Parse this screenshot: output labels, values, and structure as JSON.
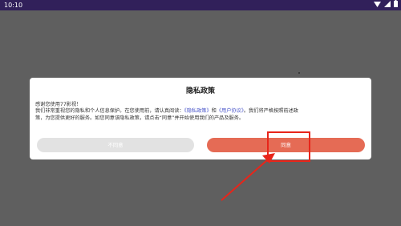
{
  "status_bar": {
    "time": "10:10"
  },
  "dialog": {
    "title": "隐私政策",
    "greeting": "感谢您使用77影视！",
    "line1_a": "我们非常重视您的隐私和个人信息保护。在您使用前，请认真阅读：",
    "privacy_link": "《隐私政策》",
    "and": "和",
    "terms_link": "《用户协议》",
    "line1_b": "。我们将严格按照前述政",
    "line2": "策，为您提供更好的服务。如您同意该隐私政策，请点击“同意”并开始使用我们的产品及服务。",
    "decline_label": "不同意",
    "agree_label": "同意"
  },
  "colors": {
    "status_bar": "#31205a",
    "overlay": "#5f5f5f",
    "agree_button": "#e56b55",
    "decline_button": "#e2e2e2",
    "link": "#4a56c9",
    "annotation": "#e8251a"
  },
  "icons": [
    "wifi-icon",
    "signal-icon",
    "battery-icon"
  ]
}
